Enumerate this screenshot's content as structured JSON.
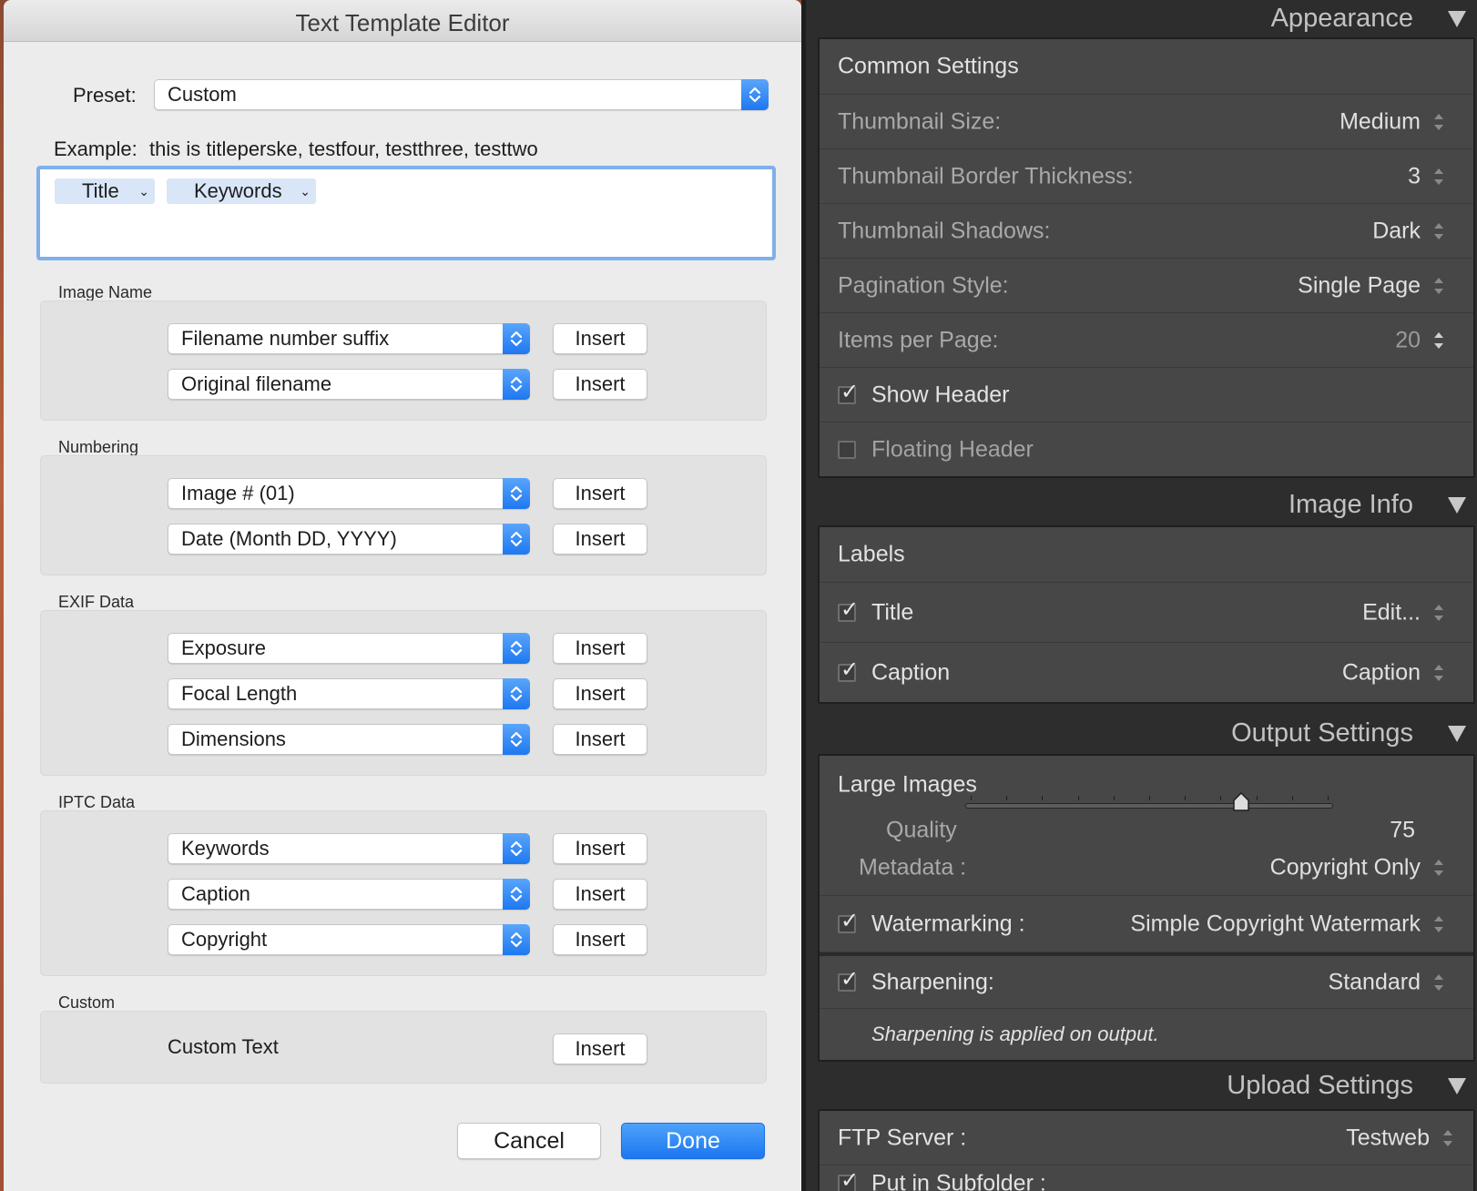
{
  "dialog": {
    "title": "Text Template Editor",
    "preset_label": "Preset:",
    "preset_value": "Custom",
    "example_label": "Example:",
    "example_value": "this is titleperske, testfour, testthree, testtwo",
    "tokens": [
      "Title",
      "Keywords"
    ],
    "insert_label": "Insert",
    "groups": [
      {
        "label": "Image Name",
        "popups": [
          "Filename number suffix",
          "Original filename"
        ]
      },
      {
        "label": "Numbering",
        "popups": [
          "Image # (01)",
          "Date (Month DD, YYYY)"
        ]
      },
      {
        "label": "EXIF Data",
        "popups": [
          "Exposure",
          "Focal Length",
          "Dimensions"
        ]
      },
      {
        "label": "IPTC Data",
        "popups": [
          "Keywords",
          "Caption",
          "Copyright"
        ]
      },
      {
        "label": "Custom",
        "custom_text": "Custom Text"
      }
    ],
    "cancel_label": "Cancel",
    "done_label": "Done"
  },
  "panel": {
    "appearance": {
      "title": "Appearance",
      "common_settings": "Common Settings",
      "rows": [
        {
          "label": "Thumbnail Size:",
          "value": "Medium"
        },
        {
          "label": "Thumbnail Border Thickness:",
          "value": "3"
        },
        {
          "label": "Thumbnail Shadows:",
          "value": "Dark"
        },
        {
          "label": "Pagination Style:",
          "value": "Single Page"
        },
        {
          "label": "Items per Page:",
          "value": "20"
        }
      ],
      "show_header": {
        "label": "Show Header",
        "checked": true
      },
      "floating_header": {
        "label": "Floating Header",
        "checked": false
      }
    },
    "image_info": {
      "title": "Image Info",
      "labels_heading": "Labels",
      "title_row": {
        "label": "Title",
        "value": "Edit...",
        "checked": true
      },
      "caption_row": {
        "label": "Caption",
        "value": "Caption",
        "checked": true
      }
    },
    "output_settings": {
      "title": "Output Settings",
      "large_images": "Large Images",
      "quality_label": "Quality",
      "quality_value": "75",
      "quality_fraction": 0.75,
      "metadata_label": "Metadata :",
      "metadata_value": "Copyright Only",
      "watermarking_label": "Watermarking :",
      "watermarking_value": "Simple Copyright Watermark",
      "sharpening_label": "Sharpening:",
      "sharpening_value": "Standard",
      "sharpening_note": "Sharpening is applied on output."
    },
    "upload_settings": {
      "title": "Upload Settings",
      "ftp_label": "FTP Server :",
      "ftp_value": "Testweb",
      "subfolder_label": "Put in Subfolder :"
    }
  },
  "colors": {
    "accent_blue": "#1e78f0",
    "dialog_bg": "#ececec",
    "panel_bg": "#2d2d2d",
    "panel_box": "#474747"
  }
}
